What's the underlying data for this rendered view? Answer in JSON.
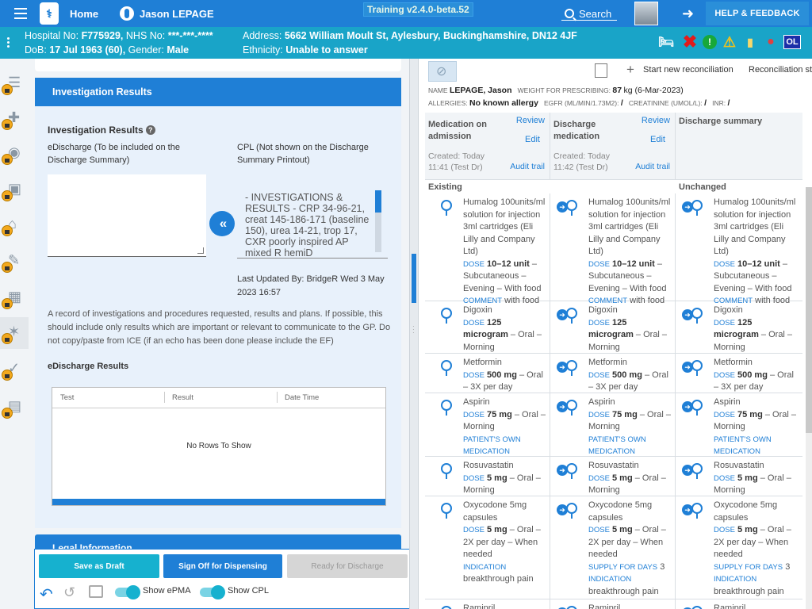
{
  "topbar": {
    "home": "Home",
    "patient_name": "Jason LEPAGE",
    "version": "Training v2.4.0-beta.52",
    "search": "Search",
    "help": "HELP & FEEDBACK"
  },
  "banner": {
    "hospital_label": "Hospital No:",
    "hospital_no": "F775929,",
    "nhs_label": "NHS No:",
    "nhs_no": "***-***-****",
    "dob_label": "DoB:",
    "dob": "17 Jul 1963 (60),",
    "gender_label": "Gender:",
    "gender": "Male",
    "address_label": "Address:",
    "address": "5662 William Moult St, Aylesbury, Buckinghamshire, DN12 4JF",
    "ethnicity_label": "Ethnicity:",
    "ethnicity": "Unable to answer",
    "ol_badge": "OL"
  },
  "left": {
    "section_title": "Investigation Results",
    "inv_label": "Investigation Results",
    "edis_label": "eDischarge (To be included on the Discharge Summary)",
    "cpl_label": "CPL (Not shown on the Discharge Summary Printout)",
    "cpl_text": "- INVESTIGATIONS & RESULTS - CRP 34-96-21, creat 145-186-171 (baseline 150), urea 14-21, trop 17, CXR poorly inspired AP mixed R hemiD",
    "last_updated": "Last Updated By: BridgeR Wed 3 May 2023 16:57",
    "description": "A record of investigations and procedures requested, results and plans. If possible, this should include only results which are important or relevant to communicate to the GP. Do not copy/paste from ICE (if an echo has been done please include the EF)",
    "results_label": "eDischarge Results",
    "grid_cols": [
      "Test",
      "Result",
      "Date Time"
    ],
    "no_rows": "No Rows To Show",
    "next_section": "Legal Information"
  },
  "footer": {
    "draft": "Save as Draft",
    "signoff": "Sign Off for Dispensing",
    "ready": "Ready for Discharge",
    "show_epma": "Show ePMA",
    "show_cpl": "Show CPL"
  },
  "right": {
    "start_recon": "Start new reconciliation",
    "recon_status": "Reconciliation status",
    "name_label": "NAME",
    "name": "LEPAGE, Jason",
    "weight_label": "WEIGHT FOR PRESCRIBING:",
    "weight": "87",
    "weight_unit": "kg (6-Mar-2023)",
    "allergies_label": "ALLERGIES:",
    "allergies": "No known allergy",
    "egfr_label": "EGFR (ML/MIN/1.73M2):",
    "egfr": "/",
    "creat_label": "CREATININE (UMOL/L):",
    "creat": "/",
    "inr_label": "INR:",
    "inr": "/",
    "col1": {
      "title": "Medication on admission",
      "review": "Review",
      "edit": "Edit",
      "created": "Created: Today 11:41 (Test Dr)",
      "audit": "Audit trail"
    },
    "col2": {
      "title": "Discharge medication",
      "review": "Review",
      "edit": "Edit",
      "created": "Created: Today 11:42 (Test Dr)",
      "audit": "Audit trail"
    },
    "col3": {
      "title": "Discharge summary"
    },
    "group_existing": "Existing",
    "group_unchanged": "Unchanged",
    "meds": [
      {
        "name": "Humalog 100units/ml solution for injection 3ml cartridges (Eli Lilly and Company Ltd)",
        "dose_kw": "DOSE",
        "dose": "10–12 unit",
        "route": "– Subcutaneous – Evening – With food",
        "extra_kw": "COMMENT",
        "extra": "with food"
      },
      {
        "name": "Digoxin",
        "dose_kw": "DOSE",
        "dose": "125 microgram",
        "route": "– Oral – Morning",
        "extra_kw": "",
        "extra": ""
      },
      {
        "name": "Metformin",
        "dose_kw": "DOSE",
        "dose": "500 mg",
        "route": "– Oral – 3X per day",
        "extra_kw": "",
        "extra": ""
      },
      {
        "name": "Aspirin",
        "dose_kw": "DOSE",
        "dose": "75 mg",
        "route": "– Oral – Morning",
        "extra_kw": "PATIENT'S OWN MEDICATION",
        "extra": ""
      },
      {
        "name": "Rosuvastatin",
        "dose_kw": "DOSE",
        "dose": "5 mg",
        "route": "– Oral – Morning",
        "extra_kw": "",
        "extra": ""
      },
      {
        "name": "Oxycodone 5mg capsules",
        "dose_kw": "DOSE",
        "dose": "5 mg",
        "route": "– Oral – 2X per day – When needed",
        "extra_kw": "INDICATION",
        "extra": "breakthrough pain"
      },
      {
        "name": "Ramipril",
        "dose_kw": "",
        "dose": "",
        "route": "",
        "extra_kw": "",
        "extra": ""
      }
    ],
    "supply_kw": "SUPPLY FOR DAYS",
    "supply_days": "3"
  },
  "colors": {
    "primary": "#1f7fd6",
    "banner": "#19a4c8",
    "accent": "#16b1cf"
  }
}
